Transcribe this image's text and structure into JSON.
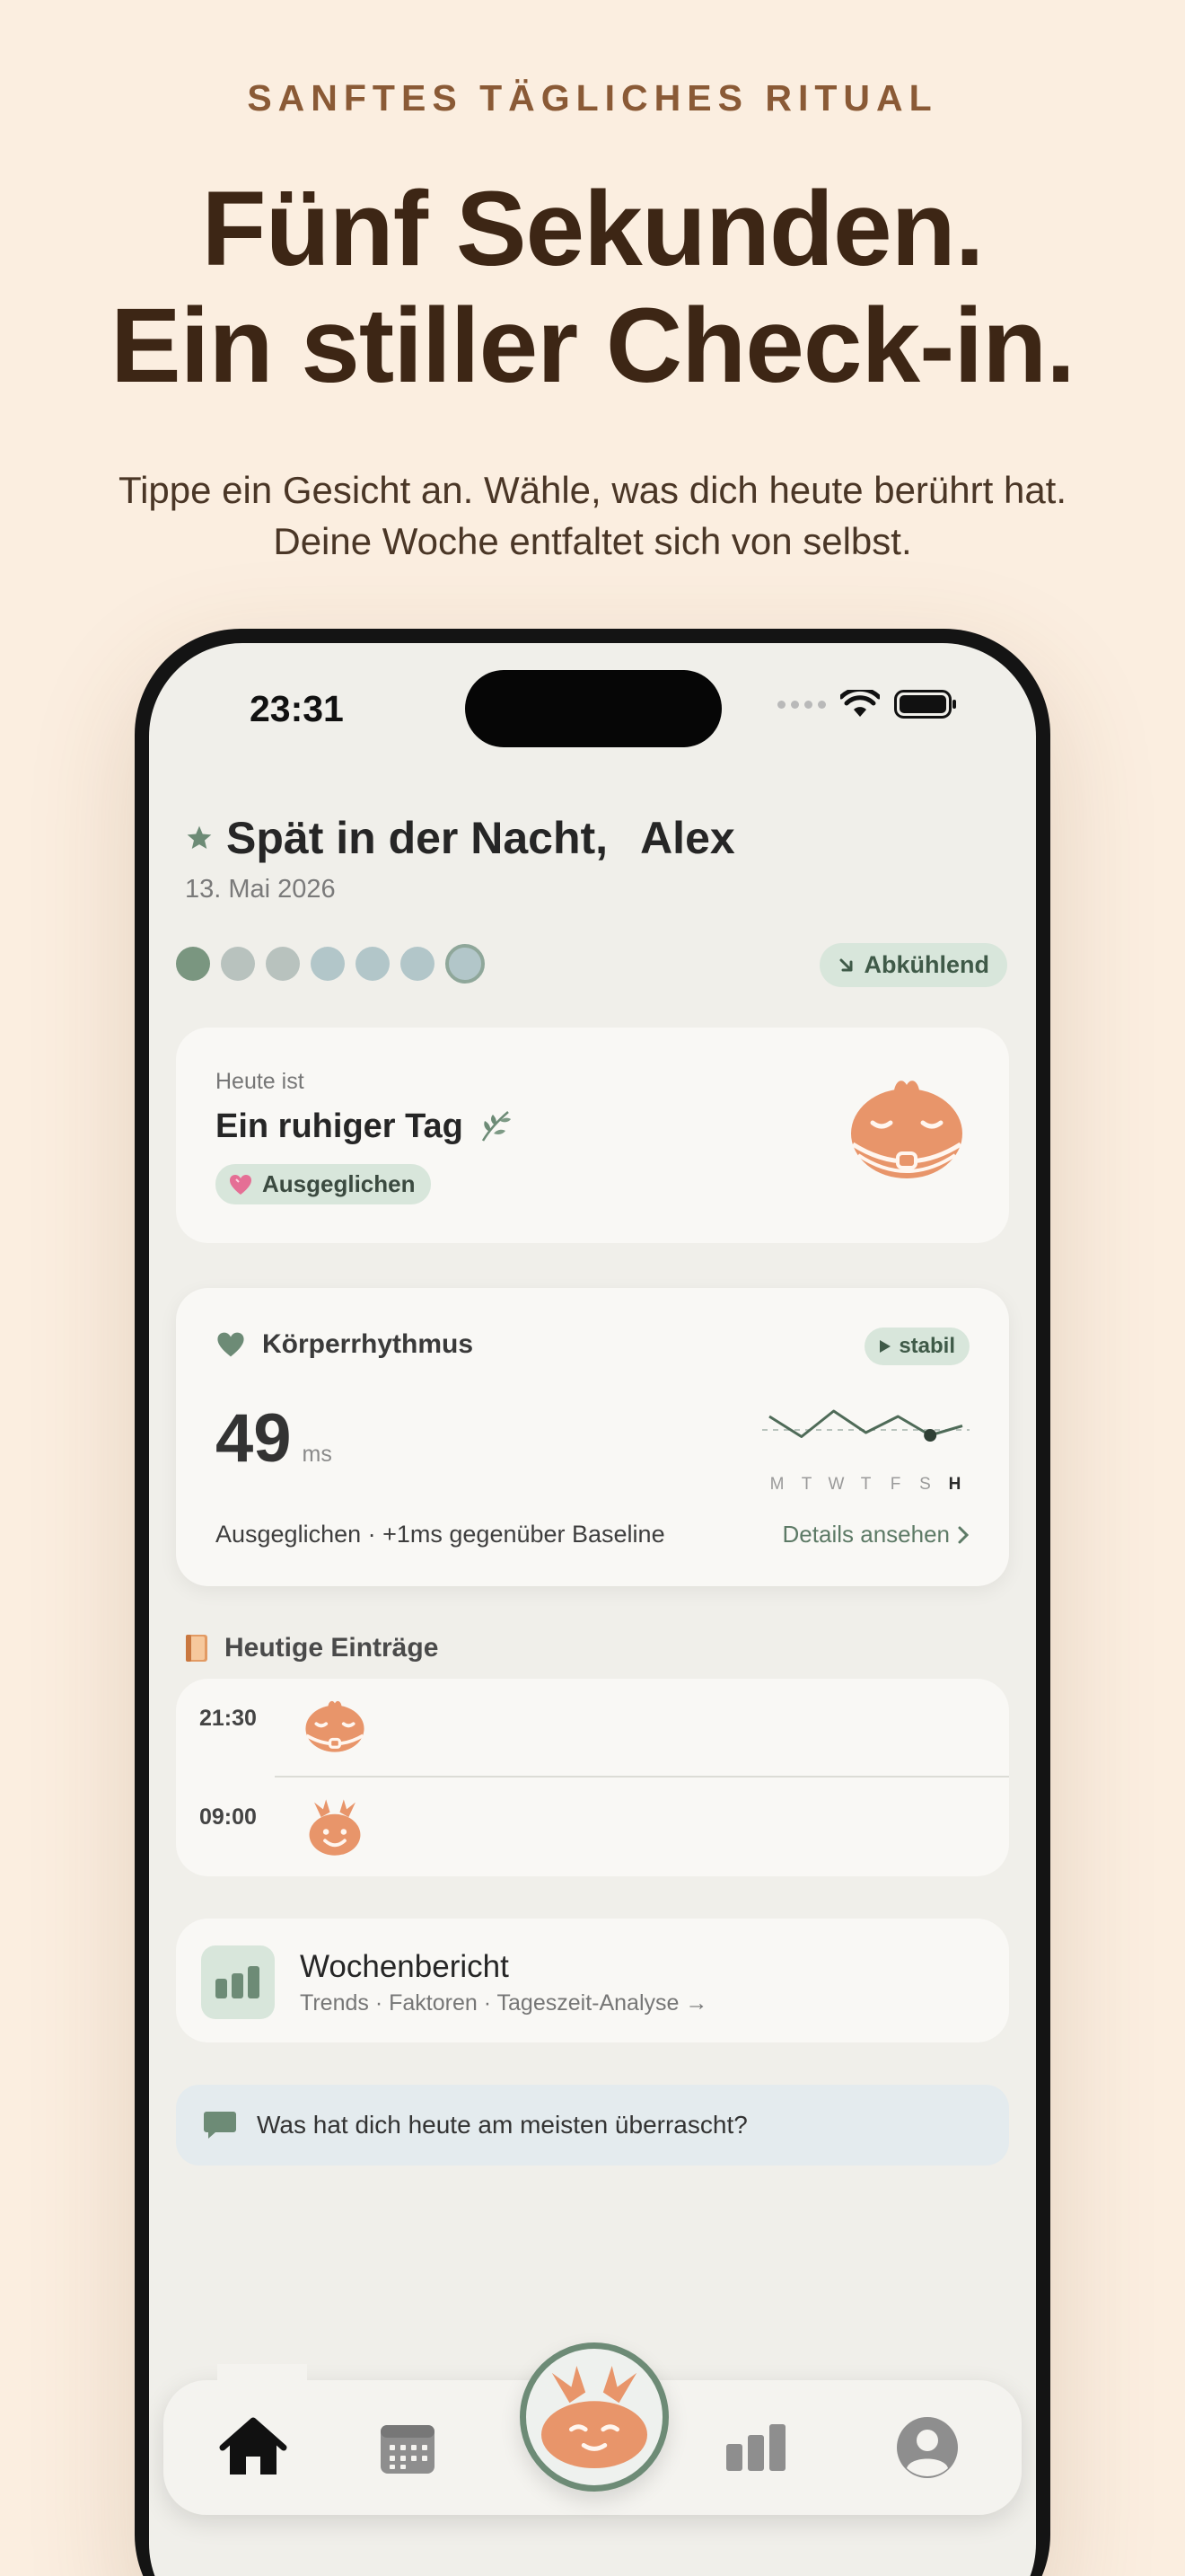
{
  "marketing": {
    "eyebrow": "SANFTES TÄGLICHES RITUAL",
    "headline_line1": "Fünf Sekunden.",
    "headline_line2": "Ein stiller Check-in.",
    "sub_line1": "Tippe ein Gesicht an. Wähle, was dich heute berührt hat.",
    "sub_line2": "Deine Woche entfaltet sich von selbst."
  },
  "status_bar": {
    "time": "23:31",
    "icons": [
      "signal-icon",
      "wifi-icon",
      "battery-icon"
    ]
  },
  "greeting": {
    "title": "Spät in der Nacht,",
    "name": "Alex",
    "date": "13. Mai 2026",
    "icon": "star-icon"
  },
  "week": {
    "dots": [
      {
        "color": "#7a9680"
      },
      {
        "color": "#b8c2be"
      },
      {
        "color": "#b8c2be"
      },
      {
        "color": "#b2c6c9"
      },
      {
        "color": "#b2c6c9"
      },
      {
        "color": "#b2c6c9"
      },
      {
        "color": "#b2c6c9",
        "today": true
      }
    ],
    "trend_label": "Abkühlend",
    "trend_icon": "arrow-down-right-icon"
  },
  "mood_card": {
    "eyebrow": "Heute ist",
    "title": "Ein ruhiger Tag",
    "title_icon": "leaf-icon",
    "badge": "Ausgeglichen",
    "badge_icon": "heart-icon",
    "face_color": "#e8956a"
  },
  "body_card": {
    "title": "Körperrhythmus",
    "icon": "heart-icon",
    "chip": "stabil",
    "value": "49",
    "unit": "ms",
    "days": [
      "M",
      "T",
      "W",
      "T",
      "F",
      "S",
      "H"
    ],
    "spark_values": [
      60,
      45,
      64,
      48,
      60,
      46,
      53
    ],
    "footer": "Ausgeglichen · +1ms gegenüber Baseline",
    "link": "Details ansehen"
  },
  "entries": {
    "title": "Heutige Einträge",
    "icon": "book-icon",
    "items": [
      {
        "time": "21:30",
        "face": "calm-face-icon"
      },
      {
        "time": "09:00",
        "face": "happy-face-icon"
      }
    ]
  },
  "report": {
    "title": "Wochenbericht",
    "subtitle": "Trends · Faktoren · Tageszeit-Analyse →",
    "icon": "bar-chart-icon"
  },
  "prompt": {
    "text": "Was hat dich heute am meisten überrascht?",
    "icon": "chat-bubble-icon"
  },
  "tabbar": {
    "items": [
      "home-icon",
      "calendar-icon",
      "checkin-face-icon",
      "stats-icon",
      "profile-icon"
    ],
    "active": "home-icon"
  },
  "colors": {
    "background": "#fbeee0",
    "accent_green": "#6d8b76",
    "face_orange": "#e8956a",
    "chip_green": "#d8e6db"
  }
}
